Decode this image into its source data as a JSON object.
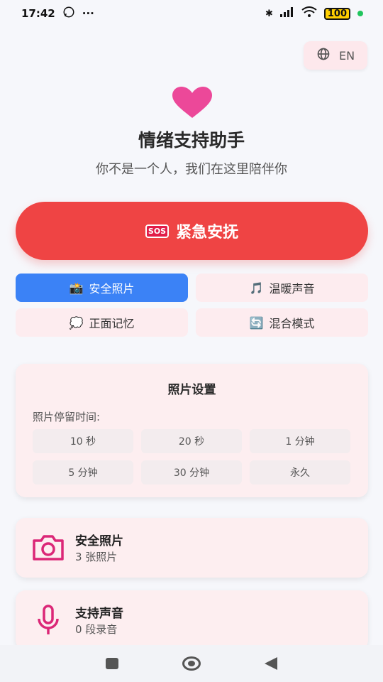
{
  "status_bar": {
    "time": "17:42",
    "more": "···",
    "battery": "100"
  },
  "language_button": {
    "label": "EN"
  },
  "header": {
    "title": "情绪支持助手",
    "subtitle": "你不是一个人，我们在这里陪伴你"
  },
  "sos_button": {
    "badge": "SOS",
    "label": "紧急安抚"
  },
  "modes": [
    {
      "icon": "📸",
      "label": "安全照片",
      "active": true
    },
    {
      "icon": "🎵",
      "label": "温暖声音",
      "active": false
    },
    {
      "icon": "💭",
      "label": "正面记忆",
      "active": false
    },
    {
      "icon": "🔄",
      "label": "混合模式",
      "active": false
    }
  ],
  "photo_settings": {
    "title": "照片设置",
    "label": "照片停留时间:",
    "options": [
      "10 秒",
      "20 秒",
      "1 分钟",
      "5 分钟",
      "30 分钟",
      "永久"
    ]
  },
  "cards": [
    {
      "icon": "camera-icon",
      "title": "安全照片",
      "subtitle": "3 张照片"
    },
    {
      "icon": "microphone-icon",
      "title": "支持声音",
      "subtitle": "0 段录音"
    }
  ],
  "colors": {
    "accent_red": "#ef4444",
    "accent_blue": "#3b82f6",
    "heart_pink": "#ec4899",
    "card_bg": "#fdeef0"
  }
}
